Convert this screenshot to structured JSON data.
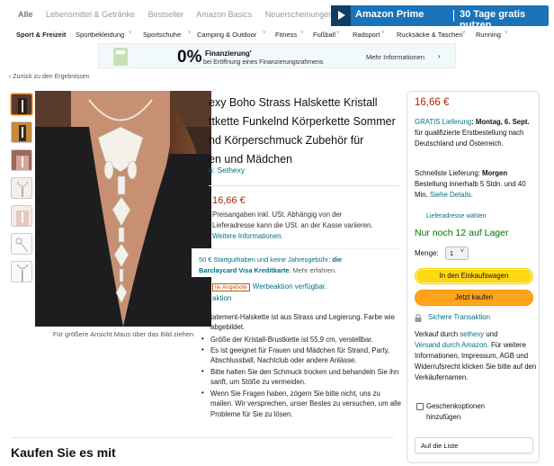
{
  "top_categories": [
    "Alle",
    "Lebensmittel & Getränke",
    "Bestseller",
    "Amazon Basics",
    "Neuerscheinungen"
  ],
  "prime_banner": {
    "text1": "Amazon Prime",
    "text2": "30 Tage gratis nutzen"
  },
  "subnav": [
    "Sport & Freizeit",
    "Sportbekleidung",
    "Sportschuhe",
    "Camping & Outdoor",
    "Fitness",
    "Fußball",
    "Radsport",
    "Rucksäcke & Taschen",
    "Running"
  ],
  "promo": {
    "percent": "0%",
    "title": "Finanzierung'",
    "subtitle": "bei Eröffnung eines Finanzierungsrahmens",
    "more": "Mehr Informationen",
    "more_arrow": "›"
  },
  "back_link": "‹ Zurück zu den Ergebnissen",
  "image_caption": "Für größere Ansicht Maus über das Bild ziehen",
  "product": {
    "title_lines": [
      "exy Boho Strass Halskette Kristall",
      "ttkette Funkelnd Körperkette Sommer",
      "nd Körperschmuck Zubehör für",
      "en und Mädchen"
    ],
    "brand": "n: Sethexy",
    "price": "16,66 €",
    "price_note_1": "Preisangaben inkl. USt. Abhängig von der",
    "price_note_2": "Lieferadresse kann die USt. an der Kasse variieren.",
    "price_note_link": "Weitere Informationen.",
    "popup_line1_a": "50 € Startguthaben und keine Jahresgebühr: ",
    "popup_line1_b": "die",
    "popup_line2_b": "Barclaycard Visa Kreditkarte",
    "popup_line2_c": ". Mehr erfahren.",
    "deal_badge": "lle Angebote",
    "deal_text": "Werbeaktion verfügbar.",
    "deal_link": "aktion",
    "bullets": [
      "tatement-Halskette ist aus Strass und Legierung. Farbe wie abgebildet.",
      "Größe der Kristall-Brustkette ist 55,9 cm, verstellbar.",
      "Es ist geeignet für Frauen und Mädchen für Strand, Party, Abschlussball, Nachtclub oder andere Anlässe.",
      "Bitte halten Sie den Schmuck trocken und behandeln Sie ihn sanft, um Stöße zu vermeiden.",
      "Wenn Sie Fragen haben, zögern Sie bitte nicht, uns zu mailen. Wir versprechen, unser Bestes zu versuchen, um alle Probleme für Sie zu lösen."
    ]
  },
  "buybox": {
    "price": "16,66 €",
    "ship_link": "GRATIS Lieferung",
    "ship_date": ": Montag, 6. Sept.",
    "ship_rest": " für qualifizierte Erstbestellung nach Deutschland und Österreich.",
    "fast_label": "Schnellste Lieferung: ",
    "fast_day": "Morgen",
    "fast_rest": "Bestellung innerhalb 5 Stdn. und 40 Min. ",
    "fast_link": "Siehe Details.",
    "address": "Lieferadresse wählen",
    "stock": "Nur noch 12 auf Lager",
    "qty_label": "Menge:",
    "qty_value": "1",
    "cart_button": "In den Einkaufswagen",
    "buy_button": "Jetzt kaufen",
    "secure": "Sichere Transaktion",
    "seller_1": "Verkauf durch ",
    "seller_link": "sethexy",
    "seller_2": " und",
    "shipper_link": "Versand durch Amazon",
    "seller_3": ". Für weitere Informationen, Impressum, AGB und Widerrufsrecht klicken Sie bitte auf den Verkäufernamen.",
    "gift_1": "Geschenkoptionen",
    "gift_2": "hinzufügen",
    "list_button": "Auf die Liste"
  },
  "also_title": "Kaufen Sie es mit"
}
